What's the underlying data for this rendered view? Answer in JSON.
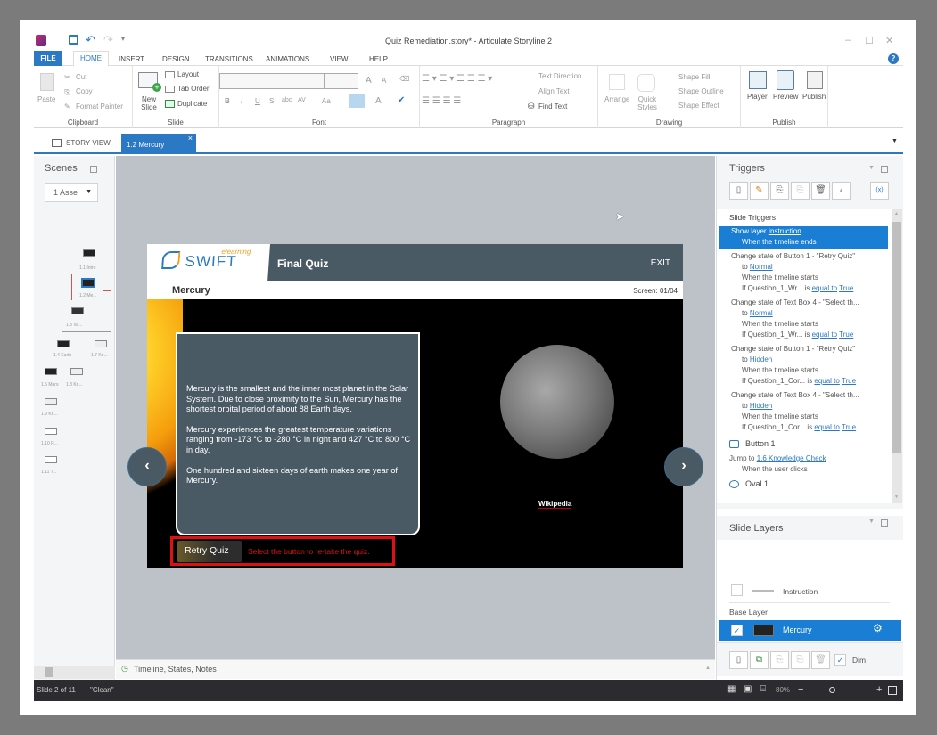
{
  "window": {
    "title": "Quiz Remediation.story* - Articulate Storyline 2",
    "controls": {
      "minimize": "–",
      "maximize": "☐",
      "close": "✕"
    },
    "help": "?"
  },
  "qat": {
    "save": "save-icon",
    "undo": "undo-icon",
    "redo": "redo-icon",
    "customize": "▾"
  },
  "ribbon_tabs": [
    {
      "label": "FILE",
      "active": false
    },
    {
      "label": "HOME",
      "active": true
    },
    {
      "label": "INSERT"
    },
    {
      "label": "DESIGN"
    },
    {
      "label": "TRANSITIONS"
    },
    {
      "label": "ANIMATIONS"
    },
    {
      "label": "VIEW"
    },
    {
      "label": "HELP"
    }
  ],
  "ribbon": {
    "clipboard": {
      "label": "Clipboard",
      "paste": "Paste",
      "cut": "Cut",
      "copy": "Copy",
      "format_painter": "Format Painter"
    },
    "slide": {
      "label": "Slide",
      "new_slide": "New Slide",
      "layout": "Layout",
      "tab_order": "Tab Order",
      "duplicate": "Duplicate"
    },
    "font": {
      "label": "Font",
      "font_name": "",
      "font_size": "",
      "bold": "B",
      "italic": "I",
      "underline": "U",
      "shadow": "S",
      "strike": "abc",
      "spacing": "AV",
      "case": "Aa",
      "color": "A",
      "grow": "A",
      "shrink": "A"
    },
    "paragraph": {
      "label": "Paragraph",
      "text_direction": "Text Direction",
      "align_text": "Align Text",
      "find_text": "Find Text"
    },
    "drawing": {
      "label": "Drawing",
      "arrange": "Arrange",
      "quick_styles": "Quick Styles",
      "shape_fill": "Shape Fill",
      "shape_outline": "Shape Outline",
      "shape_effect": "Shape Effect"
    },
    "publish": {
      "label": "Publish",
      "player": "Player",
      "preview": "Preview",
      "publish": "Publish"
    }
  },
  "doc_tabs": {
    "story_view": "STORY VIEW",
    "active_tab": "1.2 Mercury",
    "close": "×"
  },
  "scenes": {
    "title": "Scenes",
    "selected": "1 Asse",
    "thumbnails": [
      "1.1 Intro",
      "1.2 Me...",
      "1.3 Va...",
      "1.4 Earth",
      "1.7 Kn...",
      "1.5 Mars",
      "1.8 Kn...",
      "1.9 Kn...",
      "1.10 R...",
      "1.11 T..."
    ]
  },
  "slide": {
    "brand": "SWIFT",
    "brand_sub": "elearning",
    "header_title": "Final Quiz",
    "exit": "EXIT",
    "slide_name": "Mercury",
    "screen_counter": "Screen: 01/04",
    "paragraphs": [
      "Mercury is the smallest and the inner most planet in the Solar System. Due to close proximity to the Sun, Mercury has the shortest orbital period of about 88 Earth days.",
      "Mercury experiences the greatest temperature variations ranging from -173 °C to -280 °C in night and 427 °C to 800 °C in day.",
      "One hundred and sixteen days of earth makes one year of Mercury."
    ],
    "image_credit": "Wikipedia",
    "retry_button": "Retry Quiz",
    "retry_hint": "Select the button to re-take the quiz.",
    "prev": "‹",
    "next": "›"
  },
  "timeline_bar": {
    "label": "Timeline, States, Notes"
  },
  "triggers": {
    "title": "Triggers",
    "section": "Slide Triggers",
    "items": [
      {
        "lines": [
          {
            "t": "Show layer ",
            "link": "Instruction"
          },
          {
            "t": "When the timeline ends",
            "indent": true
          }
        ],
        "selected": true
      },
      {
        "lines": [
          {
            "t": "Change state of Button 1 - \"Retry Quiz\""
          },
          {
            "t": "to ",
            "link": "Normal",
            "indent": true
          },
          {
            "t": "When the timeline starts",
            "indent": true
          },
          {
            "t": "If Question_1_Wr...  is ",
            "link": "equal to",
            "link2": "True",
            "indent": true
          }
        ]
      },
      {
        "lines": [
          {
            "t": "Change state of Text Box 4 - \"Select th..."
          },
          {
            "t": "to ",
            "link": "Normal",
            "indent": true
          },
          {
            "t": "When the timeline starts",
            "indent": true
          },
          {
            "t": "If Question_1_Wr...  is ",
            "link": "equal to",
            "link2": "True",
            "indent": true
          }
        ]
      },
      {
        "lines": [
          {
            "t": "Change state of Button 1 - \"Retry Quiz\""
          },
          {
            "t": "to ",
            "link": "Hidden",
            "indent": true
          },
          {
            "t": "When the timeline starts",
            "indent": true
          },
          {
            "t": "If Question_1_Cor...  is ",
            "link": "equal to",
            "link2": "True",
            "indent": true
          }
        ]
      },
      {
        "lines": [
          {
            "t": "Change state of Text Box 4 - \"Select th..."
          },
          {
            "t": "to ",
            "link": "Hidden",
            "indent": true
          },
          {
            "t": "When the timeline starts",
            "indent": true
          },
          {
            "t": "If Question_1_Cor...  is ",
            "link": "equal to",
            "link2": "True",
            "indent": true
          }
        ]
      }
    ],
    "button1_title": "Button 1",
    "button1_action": "Jump to ",
    "button1_link": "1.6 Knowledge Check",
    "button1_when": "When the user clicks",
    "oval1_title": "Oval 1"
  },
  "layers": {
    "title": "Slide Layers",
    "instruction": "Instruction",
    "base_label": "Base Layer",
    "base_name": "Mercury",
    "dim": "Dim"
  },
  "status": {
    "slide_info": "Slide 2 of 11",
    "theme": "\"Clean\"",
    "zoom": "80%",
    "zoom_minus": "−",
    "zoom_plus": "+"
  }
}
